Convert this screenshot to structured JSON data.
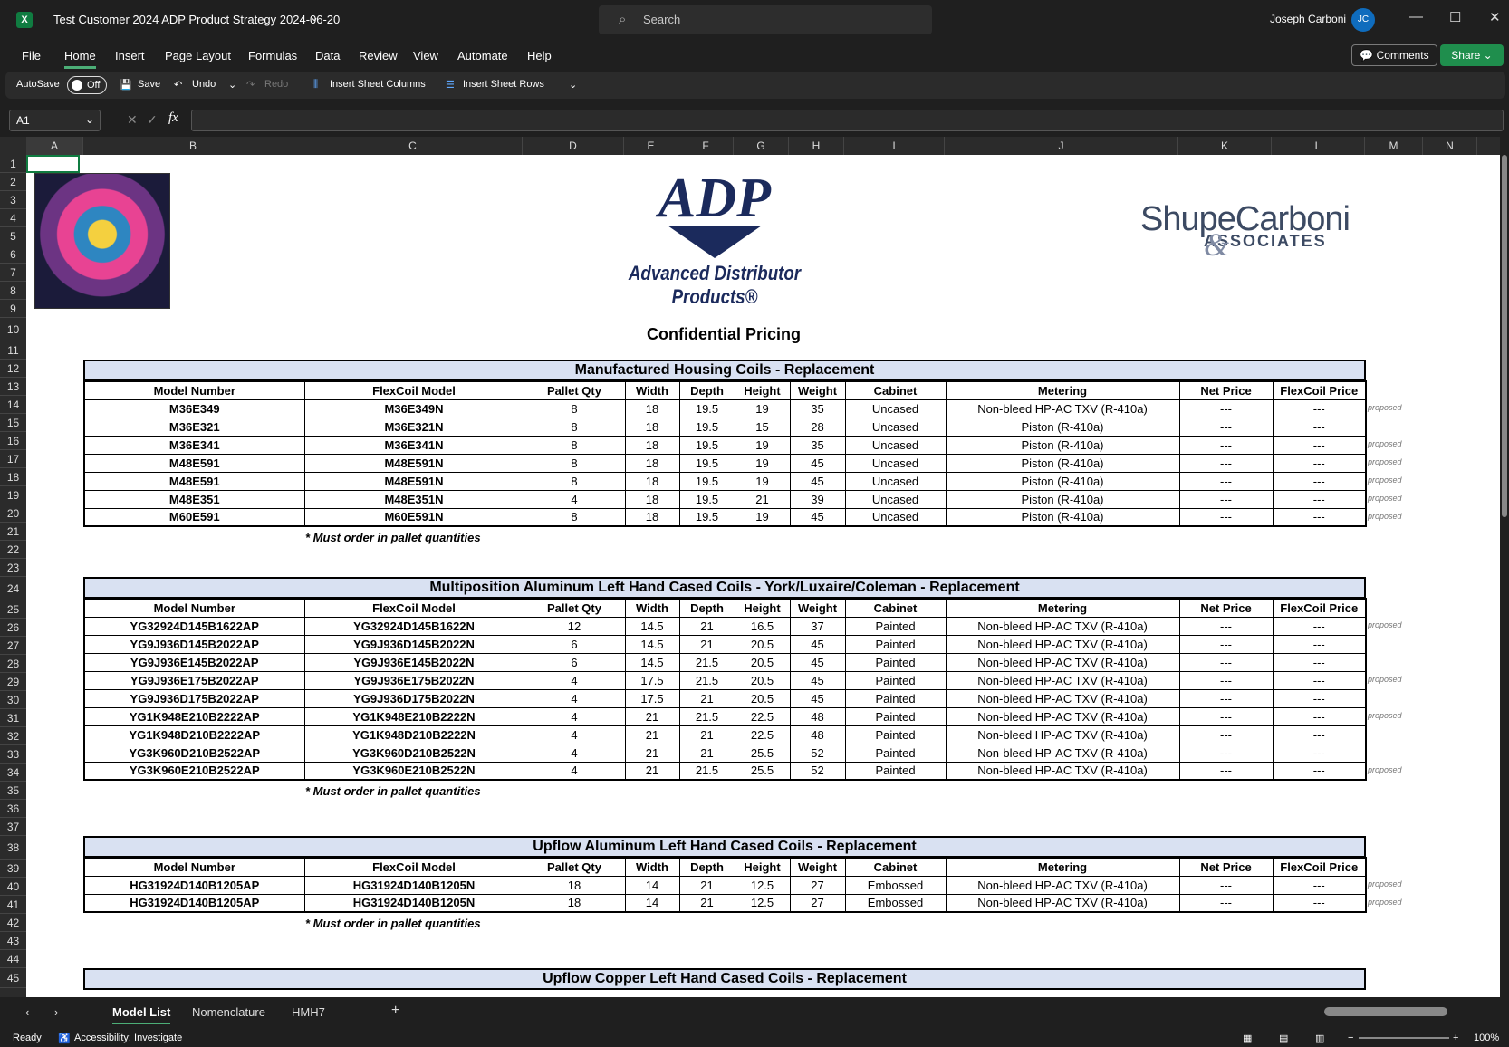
{
  "window": {
    "app_icon": "excel-logo",
    "title": "Test Customer 2024 ADP Product Strategy 2024-06-20",
    "search_placeholder": "Search",
    "user_name": "Joseph Carboni",
    "user_initials": "JC"
  },
  "menu": {
    "tabs": [
      "File",
      "Home",
      "Insert",
      "Page Layout",
      "Formulas",
      "Data",
      "Review",
      "View",
      "Automate",
      "Help"
    ],
    "active_tab": "Home",
    "comments_label": "Comments",
    "share_label": "Share"
  },
  "ribbon": {
    "autosave_label": "AutoSave",
    "autosave_state": "Off",
    "save_label": "Save",
    "undo_label": "Undo",
    "redo_label": "Redo",
    "insert_cols_label": "Insert Sheet Columns",
    "insert_rows_label": "Insert Sheet Rows"
  },
  "formula_bar": {
    "name_box": "A1",
    "fx": "fx",
    "value": ""
  },
  "columns": [
    "A",
    "B",
    "C",
    "D",
    "E",
    "F",
    "G",
    "H",
    "I",
    "J",
    "K",
    "L",
    "M",
    "N"
  ],
  "rows": [
    "1",
    "2",
    "3",
    "4",
    "5",
    "6",
    "7",
    "8",
    "9",
    "10",
    "11",
    "12",
    "13",
    "14",
    "15",
    "16",
    "17",
    "18",
    "19",
    "20",
    "21",
    "22",
    "23",
    "24",
    "25",
    "26",
    "27",
    "28",
    "29",
    "30",
    "31",
    "32",
    "33",
    "34",
    "35",
    "36",
    "37",
    "38",
    "39",
    "40",
    "41",
    "42",
    "43",
    "44",
    "45"
  ],
  "logos": {
    "adp_mark": "ADP",
    "adp_text": "Advanced Distributor Products®",
    "sca_main": "ShupeCarboni",
    "sca_amp": "&",
    "sca_sub": "ASSOCIATES"
  },
  "heading": "Confidential Pricing",
  "headers": [
    "Model Number",
    "FlexCoil Model",
    "Pallet Qty",
    "Width",
    "Depth",
    "Height",
    "Weight",
    "Cabinet",
    "Metering",
    "Net Price",
    "FlexCoil Price"
  ],
  "note": "* Must order in pallet quantities",
  "proposed_label": "proposed",
  "sections": [
    {
      "title": "Manufactured Housing Coils - Replacement",
      "rows": [
        [
          "M36E349",
          "M36E349N",
          "8",
          "18",
          "19.5",
          "19",
          "35",
          "Uncased",
          "Non-bleed HP-AC TXV (R-410a)",
          "---",
          "---"
        ],
        [
          "M36E321",
          "M36E321N",
          "8",
          "18",
          "19.5",
          "15",
          "28",
          "Uncased",
          "Piston (R-410a)",
          "---",
          "---"
        ],
        [
          "M36E341",
          "M36E341N",
          "8",
          "18",
          "19.5",
          "19",
          "35",
          "Uncased",
          "Piston (R-410a)",
          "---",
          "---"
        ],
        [
          "M48E591",
          "M48E591N",
          "8",
          "18",
          "19.5",
          "19",
          "45",
          "Uncased",
          "Piston (R-410a)",
          "---",
          "---"
        ],
        [
          "M48E591",
          "M48E591N",
          "8",
          "18",
          "19.5",
          "19",
          "45",
          "Uncased",
          "Piston (R-410a)",
          "---",
          "---"
        ],
        [
          "M48E351",
          "M48E351N",
          "4",
          "18",
          "19.5",
          "21",
          "39",
          "Uncased",
          "Piston (R-410a)",
          "---",
          "---"
        ],
        [
          "M60E591",
          "M60E591N",
          "8",
          "18",
          "19.5",
          "19",
          "45",
          "Uncased",
          "Piston (R-410a)",
          "---",
          "---"
        ]
      ],
      "proposed": [
        true,
        false,
        true,
        true,
        true,
        true,
        true
      ]
    },
    {
      "title": "Multiposition Aluminum Left Hand Cased Coils - York/Luxaire/Coleman - Replacement",
      "rows": [
        [
          "YG32924D145B1622AP",
          "YG32924D145B1622N",
          "12",
          "14.5",
          "21",
          "16.5",
          "37",
          "Painted",
          "Non-bleed HP-AC TXV (R-410a)",
          "---",
          "---"
        ],
        [
          "YG9J936D145B2022AP",
          "YG9J936D145B2022N",
          "6",
          "14.5",
          "21",
          "20.5",
          "45",
          "Painted",
          "Non-bleed HP-AC TXV (R-410a)",
          "---",
          "---"
        ],
        [
          "YG9J936E145B2022AP",
          "YG9J936E145B2022N",
          "6",
          "14.5",
          "21.5",
          "20.5",
          "45",
          "Painted",
          "Non-bleed HP-AC TXV (R-410a)",
          "---",
          "---"
        ],
        [
          "YG9J936E175B2022AP",
          "YG9J936E175B2022N",
          "4",
          "17.5",
          "21.5",
          "20.5",
          "45",
          "Painted",
          "Non-bleed HP-AC TXV (R-410a)",
          "---",
          "---"
        ],
        [
          "YG9J936D175B2022AP",
          "YG9J936D175B2022N",
          "4",
          "17.5",
          "21",
          "20.5",
          "45",
          "Painted",
          "Non-bleed HP-AC TXV (R-410a)",
          "---",
          "---"
        ],
        [
          "YG1K948E210B2222AP",
          "YG1K948E210B2222N",
          "4",
          "21",
          "21.5",
          "22.5",
          "48",
          "Painted",
          "Non-bleed HP-AC TXV (R-410a)",
          "---",
          "---"
        ],
        [
          "YG1K948D210B2222AP",
          "YG1K948D210B2222N",
          "4",
          "21",
          "21",
          "22.5",
          "48",
          "Painted",
          "Non-bleed HP-AC TXV (R-410a)",
          "---",
          "---"
        ],
        [
          "YG3K960D210B2522AP",
          "YG3K960D210B2522N",
          "4",
          "21",
          "21",
          "25.5",
          "52",
          "Painted",
          "Non-bleed HP-AC TXV (R-410a)",
          "---",
          "---"
        ],
        [
          "YG3K960E210B2522AP",
          "YG3K960E210B2522N",
          "4",
          "21",
          "21.5",
          "25.5",
          "52",
          "Painted",
          "Non-bleed HP-AC TXV (R-410a)",
          "---",
          "---"
        ]
      ],
      "proposed": [
        true,
        false,
        false,
        true,
        false,
        true,
        false,
        false,
        true
      ]
    },
    {
      "title": "Upflow Aluminum Left Hand Cased Coils - Replacement",
      "rows": [
        [
          "HG31924D140B1205AP",
          "HG31924D140B1205N",
          "18",
          "14",
          "21",
          "12.5",
          "27",
          "Embossed",
          "Non-bleed HP-AC TXV (R-410a)",
          "---",
          "---"
        ],
        [
          "HG31924D140B1205AP",
          "HG31924D140B1205N",
          "18",
          "14",
          "21",
          "12.5",
          "27",
          "Embossed",
          "Non-bleed HP-AC TXV (R-410a)",
          "---",
          "---"
        ]
      ],
      "proposed": [
        true,
        true
      ]
    },
    {
      "title": "Upflow Copper Left Hand Cased Coils - Replacement",
      "rows": [],
      "proposed": []
    }
  ],
  "sheet_tabs": [
    "Model List",
    "Nomenclature",
    "HMH7"
  ],
  "active_sheet": "Model List",
  "status": {
    "ready": "Ready",
    "accessibility": "Accessibility: Investigate",
    "zoom": "100%"
  }
}
